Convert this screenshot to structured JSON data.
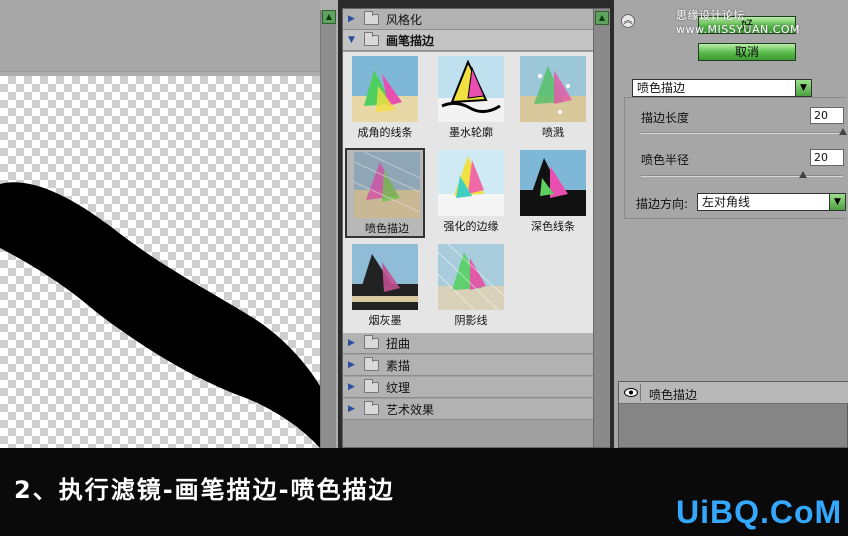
{
  "browser": {
    "categories_top": [
      {
        "label": "风格化",
        "expanded": false
      },
      {
        "label": "画笔描边",
        "expanded": true
      }
    ],
    "thumbnails": [
      {
        "label": "成角的线条",
        "selected": false
      },
      {
        "label": "墨水轮廓",
        "selected": false
      },
      {
        "label": "喷溅",
        "selected": false
      },
      {
        "label": "喷色描边",
        "selected": true
      },
      {
        "label": "强化的边缘",
        "selected": false
      },
      {
        "label": "深色线条",
        "selected": false
      },
      {
        "label": "烟灰墨",
        "selected": false
      },
      {
        "label": "阴影线",
        "selected": false
      }
    ],
    "categories_bottom": [
      {
        "label": "扭曲"
      },
      {
        "label": "素描"
      },
      {
        "label": "纹理"
      },
      {
        "label": "艺术效果"
      }
    ]
  },
  "settings": {
    "ok_label": "好",
    "cancel_label": "取消",
    "filter_name": "喷色描边",
    "params": [
      {
        "label": "描边长度",
        "value": "20",
        "fraction": 1.0
      },
      {
        "label": "喷色半径",
        "value": "20",
        "fraction": 0.8
      }
    ],
    "direction_label": "描边方向:",
    "direction_value": "左对角线"
  },
  "layers": {
    "active_layer": "喷色描边"
  },
  "watermark": "思缘设计论坛 www.MISSYUAN.COM",
  "caption": "2、执行滤镜-画笔描边-喷色描边",
  "brand": "UiBQ.CoM",
  "colors": {
    "accent_green": "#58b94a",
    "brand_blue": "#34a8ff"
  }
}
